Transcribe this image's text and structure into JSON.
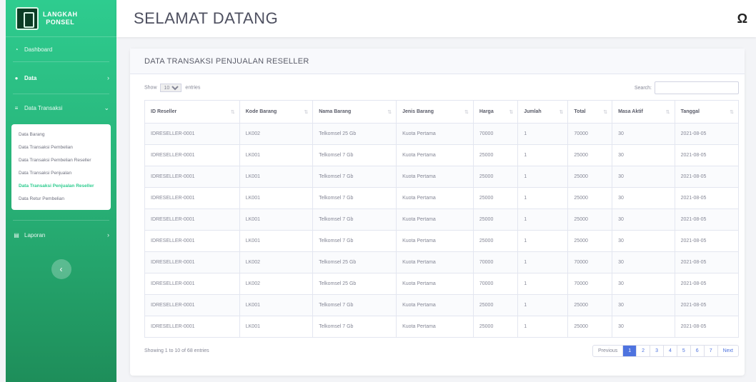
{
  "brand": {
    "line1": "LANGKAH",
    "line2": "PONSEL"
  },
  "sidebar": {
    "dashboard": "Dashboard",
    "data": "Data",
    "transaksi": "Data Transaksi",
    "submenu": [
      "Data Barang",
      "Data Transaksi Pembelian",
      "Data Transaksi Pembelian Reseller",
      "Data Transaksi Penjualan",
      "Data Transaksi Penjualan Reseller",
      "Data Retur Pembelian"
    ],
    "laporan": "Laporan"
  },
  "header": {
    "title": "SELAMAT DATANG"
  },
  "card": {
    "title": "DATA TRANSAKSI PENJUALAN RESELLER"
  },
  "controls": {
    "show_label": "Show",
    "entries_value": "10",
    "entries_label": "entries",
    "search_label": "Search:"
  },
  "table": {
    "columns": [
      "ID Reseller",
      "Kode Barang",
      "Nama Barang",
      "Jenis Barang",
      "Harga",
      "Jumlah",
      "Total",
      "Masa Aktif",
      "Tanggal"
    ],
    "rows": [
      [
        "IDRESELLER-0001",
        "LK002",
        "Telkomsel 25 Gb",
        "Kuota Pertama",
        "70000",
        "1",
        "70000",
        "30",
        "2021-08-05"
      ],
      [
        "IDRESELLER-0001",
        "LK001",
        "Telkomsel 7 Gb",
        "Kuota Pertama",
        "25000",
        "1",
        "25000",
        "30",
        "2021-08-05"
      ],
      [
        "IDRESELLER-0001",
        "LK001",
        "Telkomsel 7 Gb",
        "Kuota Pertama",
        "25000",
        "1",
        "25000",
        "30",
        "2021-08-05"
      ],
      [
        "IDRESELLER-0001",
        "LK001",
        "Telkomsel 7 Gb",
        "Kuota Pertama",
        "25000",
        "1",
        "25000",
        "30",
        "2021-08-05"
      ],
      [
        "IDRESELLER-0001",
        "LK001",
        "Telkomsel 7 Gb",
        "Kuota Pertama",
        "25000",
        "1",
        "25000",
        "30",
        "2021-08-05"
      ],
      [
        "IDRESELLER-0001",
        "LK001",
        "Telkomsel 7 Gb",
        "Kuota Pertama",
        "25000",
        "1",
        "25000",
        "30",
        "2021-08-05"
      ],
      [
        "IDRESELLER-0001",
        "LK002",
        "Telkomsel 25 Gb",
        "Kuota Pertama",
        "70000",
        "1",
        "70000",
        "30",
        "2021-08-05"
      ],
      [
        "IDRESELLER-0001",
        "LK002",
        "Telkomsel 25 Gb",
        "Kuota Pertama",
        "70000",
        "1",
        "70000",
        "30",
        "2021-08-05"
      ],
      [
        "IDRESELLER-0001",
        "LK001",
        "Telkomsel 7 Gb",
        "Kuota Pertama",
        "25000",
        "1",
        "25000",
        "30",
        "2021-08-05"
      ],
      [
        "IDRESELLER-0001",
        "LK001",
        "Telkomsel 7 Gb",
        "Kuota Pertama",
        "25000",
        "1",
        "25000",
        "30",
        "2021-08-05"
      ]
    ]
  },
  "footer": {
    "info": "Showing 1 to 10 of 68 entries",
    "pages": [
      "Previous",
      "1",
      "2",
      "3",
      "4",
      "5",
      "6",
      "7",
      "Next"
    ]
  }
}
